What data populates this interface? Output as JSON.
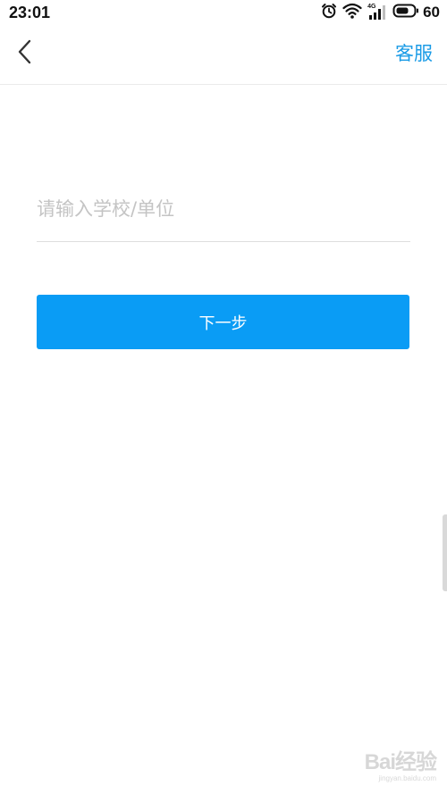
{
  "status_bar": {
    "time": "23:01",
    "network_type": "4G",
    "battery_level": "60",
    "icons": [
      "alarm-icon",
      "wifi-icon",
      "signal-icon",
      "battery-icon"
    ]
  },
  "nav": {
    "back_icon": "chevron-left-icon",
    "service_label": "客服"
  },
  "form": {
    "school_placeholder": "请输入学校/单位",
    "school_value": "",
    "next_label": "下一步"
  },
  "watermark": {
    "brand": "Bai经验",
    "sub": "jingyan.baidu.com"
  },
  "colors": {
    "accent": "#0a9cf5",
    "link": "#1a9be6",
    "placeholder": "#c4c4c4",
    "divider": "#ebebeb"
  }
}
